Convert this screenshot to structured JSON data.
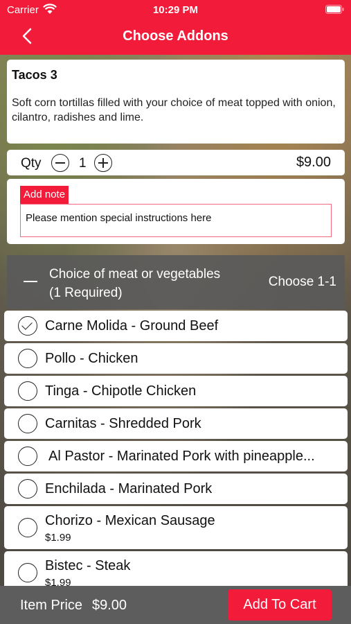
{
  "status_bar": {
    "carrier": "Carrier",
    "time": "10:29 PM"
  },
  "nav": {
    "title": "Choose Addons",
    "back_icon": "chevron-left-icon"
  },
  "item": {
    "name": "Tacos 3",
    "description": "Soft corn tortillas filled with your choice of meat topped with onion, cilantro, radishes and lime."
  },
  "quantity": {
    "label": "Qty",
    "value": "1",
    "price": "$9.00"
  },
  "note": {
    "label": "Add note",
    "placeholder": "Please mention special instructions here"
  },
  "group": {
    "title_line1": "Choice of meat or vegetables",
    "title_line2": "(1 Required)",
    "rule": "Choose 1-1",
    "options": [
      {
        "label": "Carne Molida - Ground Beef",
        "price": "",
        "checked": true
      },
      {
        "label": "Pollo - Chicken",
        "price": "",
        "checked": false
      },
      {
        "label": "Tinga - Chipotle Chicken",
        "price": "",
        "checked": false
      },
      {
        "label": "Carnitas - Shredded Pork",
        "price": "",
        "checked": false
      },
      {
        "label": "Al Pastor - Marinated Pork with pineapple...",
        "price": "",
        "checked": false
      },
      {
        "label": "Enchilada - Marinated Pork",
        "price": "",
        "checked": false
      },
      {
        "label": "Chorizo - Mexican Sausage",
        "price": "$1.99",
        "checked": false
      },
      {
        "label": "Bistec - Steak",
        "price": "$1.99",
        "checked": false
      }
    ]
  },
  "footer": {
    "price_label": "Item Price",
    "price_value": "$9.00",
    "cart_button": "Add To Cart"
  },
  "colors": {
    "accent": "#f31b3a",
    "footer_bg": "#5d5d5d",
    "group_bg": "#5a5a5a"
  }
}
